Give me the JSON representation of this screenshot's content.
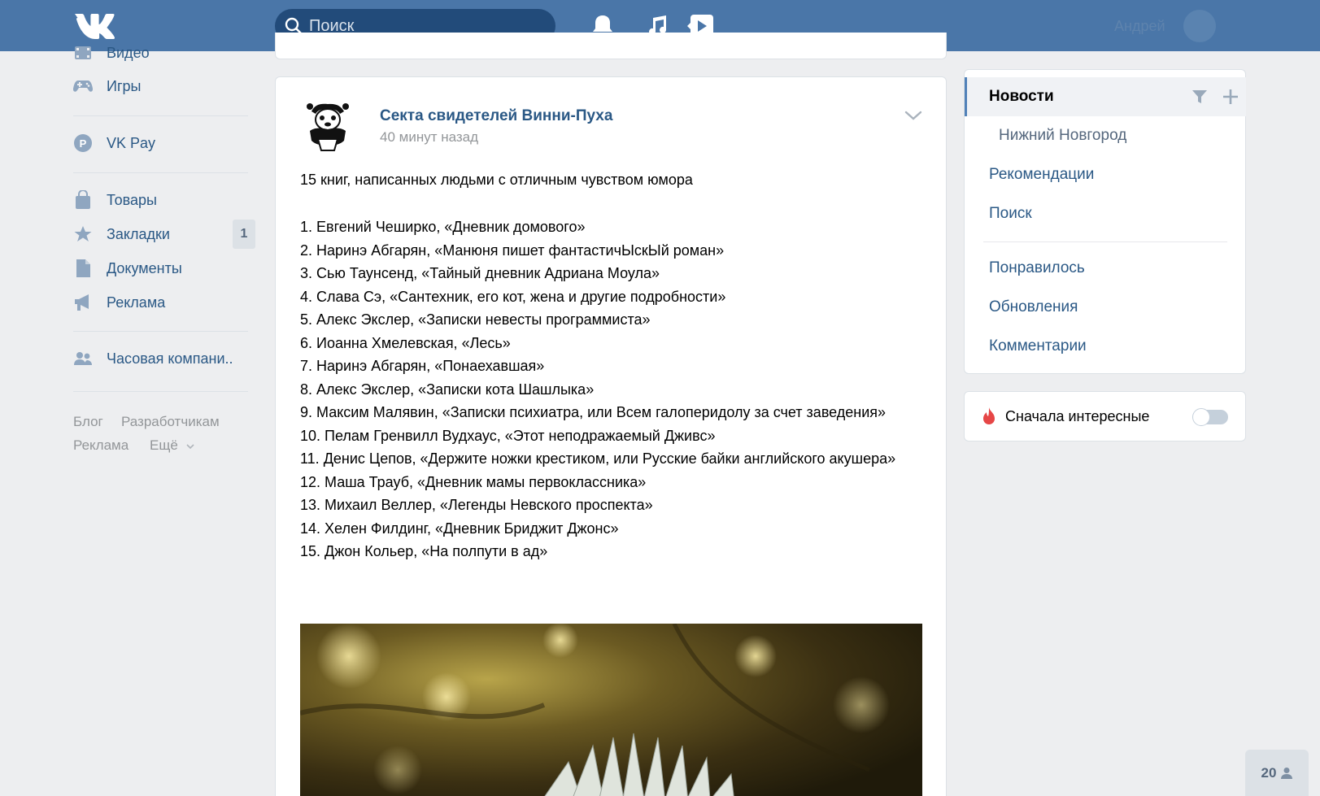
{
  "header": {
    "search_placeholder": "Поиск",
    "user_name": "Андрей"
  },
  "left_nav": {
    "items": [
      {
        "label": "Видео",
        "icon": "video-icon"
      },
      {
        "label": "Игры",
        "icon": "gamepad-icon"
      },
      {
        "label": "VK Pay",
        "icon": "vkpay-icon"
      },
      {
        "label": "Товары",
        "icon": "shopping-bag-icon"
      },
      {
        "label": "Закладки",
        "icon": "star-icon",
        "badge": "1"
      },
      {
        "label": "Документы",
        "icon": "document-icon"
      },
      {
        "label": "Реклама",
        "icon": "megaphone-icon"
      },
      {
        "label": "Часовая компани..",
        "icon": "group-icon"
      }
    ],
    "footer": {
      "blog": "Блог",
      "developers": "Разработчикам",
      "ads": "Реклама",
      "more": "Ещё"
    }
  },
  "post": {
    "author": "Секта свидетелей Винни-Пуха",
    "time": "40 минут назад",
    "title": "15 книг, написанных людьми с отличным чувством юмора",
    "list": [
      "1. Евгений Чеширко, «Дневник домового»",
      "2. Наринэ Абгарян, «Манюня пишет фантастичЫскЫй роман»",
      "3. Сью Таунсенд, «Тайный дневник Адриана Моула»",
      "4. Слава Сэ, «Сантехник, его кот, жена и другие подробности»",
      "5. Алекс Экслер, «Записки невесты программиста»",
      "6. Иоанна Хмелевская, «Лесь»",
      "7. Наринэ Абгарян, «Понаехавшая»",
      "8. Алекс Экслер, «Записки кота Шашлыка»",
      "9. Максим Малявин, «Записки психиатра, или Всем галоперидолу за счет заведения»",
      "10. Пелам Гренвилл Вудхаус, «Этот неподражаемый Дживс»",
      "11. Денис Цепов, «Держите ножки крестиком, или Русские байки английского акушера»",
      "12. Маша Трауб, «Дневник мамы первоклассника»",
      "13. Михаил Веллер, «Легенды Невского проспекта»",
      "14. Хелен Филдинг, «Дневник Бриджит Джонс»",
      "15. Джон Кольер, «На полпути в ад»"
    ]
  },
  "right_menu": {
    "active": "Новости",
    "sub_item": "Нижний Новгород",
    "items_top": [
      "Рекомендации",
      "Поиск"
    ],
    "items_bottom": [
      "Понравилось",
      "Обновления",
      "Комментарии"
    ]
  },
  "toggle": {
    "label": "Сначала интересные",
    "enabled": false
  },
  "online": {
    "count": "20"
  },
  "colors": {
    "header": "#4a76a8",
    "link": "#2a5885",
    "background": "#edeef0"
  }
}
